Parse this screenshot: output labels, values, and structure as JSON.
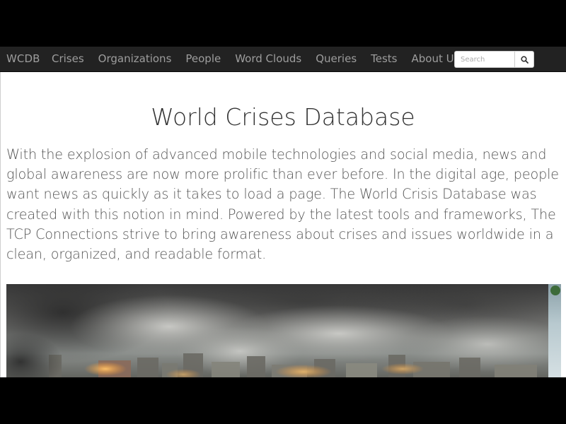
{
  "navbar": {
    "brand": "WCDB",
    "items": [
      {
        "label": "Crises"
      },
      {
        "label": "Organizations"
      },
      {
        "label": "People"
      },
      {
        "label": "Word Clouds"
      },
      {
        "label": "Queries"
      },
      {
        "label": "Tests"
      },
      {
        "label": "About Us"
      }
    ],
    "search": {
      "placeholder": "Search",
      "value": "",
      "button_icon": "search-icon"
    }
  },
  "main": {
    "title": "World Crises Database",
    "intro": "With the explosion of advanced mobile technologies and social media, news and global awareness are now more prolific than ever before. In the digital age, people want news as quickly as it takes to load a page. The World Crisis Database was created with this notion in mind. Powered by the latest tools and frameworks, The TCP Connections strive to bring awareness about crises and issues worldwide in a clean, organized, and readable format.",
    "hero_image": "smoke-covered-city-photo"
  },
  "colors": {
    "navbar_bg": "#222222",
    "nav_text": "#9d9d9d",
    "title_text": "#333333",
    "body_text": "#555555",
    "page_bg": "#ffffff",
    "letterbox": "#000000"
  }
}
